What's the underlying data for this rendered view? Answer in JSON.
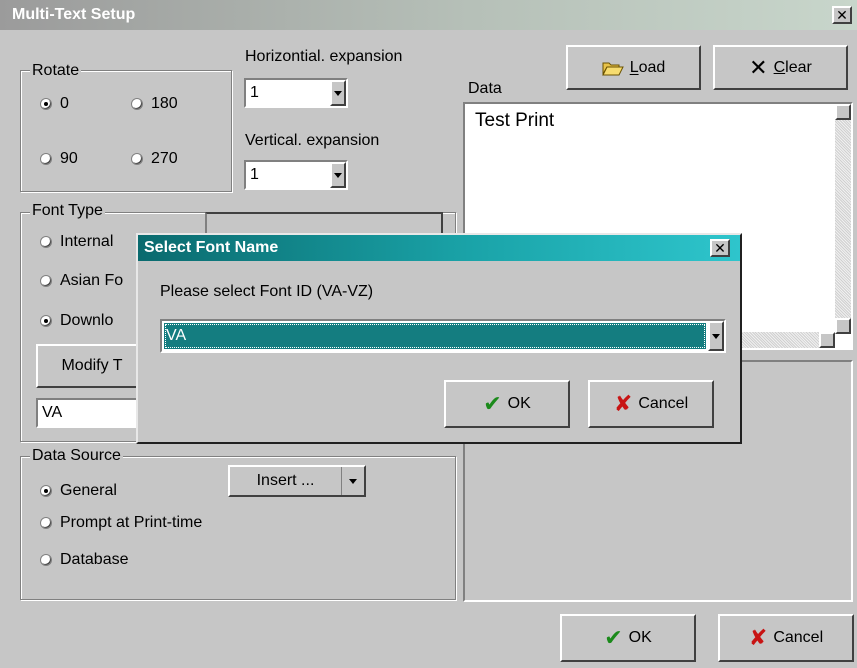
{
  "window": {
    "title": "Multi-Text Setup",
    "close_glyph": "✕"
  },
  "rotate": {
    "legend": "Rotate",
    "options": [
      {
        "label": "0",
        "selected": true
      },
      {
        "label": "180",
        "selected": false
      },
      {
        "label": "90",
        "selected": false
      },
      {
        "label": "270",
        "selected": false
      }
    ]
  },
  "horizontal_expansion": {
    "label": "Horizontial. expansion",
    "value": "1"
  },
  "vertical_expansion": {
    "label": "Vertical. expansion",
    "value": "1"
  },
  "toolbar": {
    "load_label": "Load",
    "load_mnemonic": "L",
    "clear_label": "Clear",
    "clear_mnemonic": "C"
  },
  "data_panel": {
    "label": "Data",
    "text": "Test Print"
  },
  "font_type": {
    "legend": "Font Type",
    "options": [
      {
        "label": "Internal",
        "selected": false
      },
      {
        "label": "Asian Fo",
        "selected": false
      },
      {
        "label": "Downlo",
        "selected": true
      }
    ],
    "modify_button": "Modify T",
    "font_id_value": "VA"
  },
  "data_source": {
    "legend": "Data Source",
    "options": [
      {
        "label": "General",
        "selected": true
      },
      {
        "label": "Prompt at Print-time",
        "selected": false
      },
      {
        "label": "Database",
        "selected": false
      }
    ],
    "insert_label": "Insert ..."
  },
  "footer": {
    "ok_label": "OK",
    "cancel_label": "Cancel"
  },
  "dialog": {
    "title": "Select Font Name",
    "close_glyph": "✕",
    "prompt": "Please select Font ID (VA-VZ)",
    "selected_value": "VA",
    "ok_label": "OK",
    "cancel_label": "Cancel"
  },
  "icons": {
    "load": "folder-open-icon",
    "clear": "x-icon",
    "ok": "check-icon",
    "cancel": "red-x-icon"
  }
}
